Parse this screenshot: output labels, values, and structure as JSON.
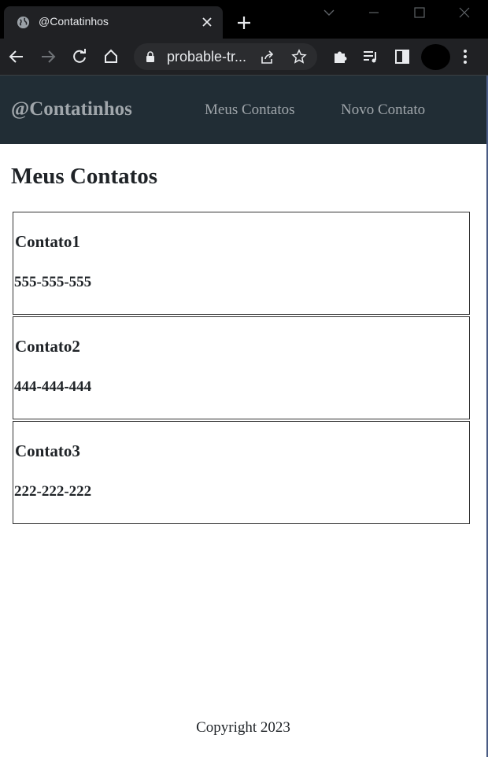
{
  "browser": {
    "tab_title": "@Contatinhos",
    "url": "probable-tr..."
  },
  "navbar": {
    "brand": "@Contatinhos",
    "links": [
      "Meus Contatos",
      "Novo Contato"
    ]
  },
  "main": {
    "title": "Meus Contatos",
    "contacts": [
      {
        "name": "Contato1",
        "phone": "555-555-555"
      },
      {
        "name": "Contato2",
        "phone": "444-444-444"
      },
      {
        "name": "Contato3",
        "phone": "222-222-222"
      }
    ]
  },
  "footer": {
    "copyright": "Copyright 2023"
  }
}
